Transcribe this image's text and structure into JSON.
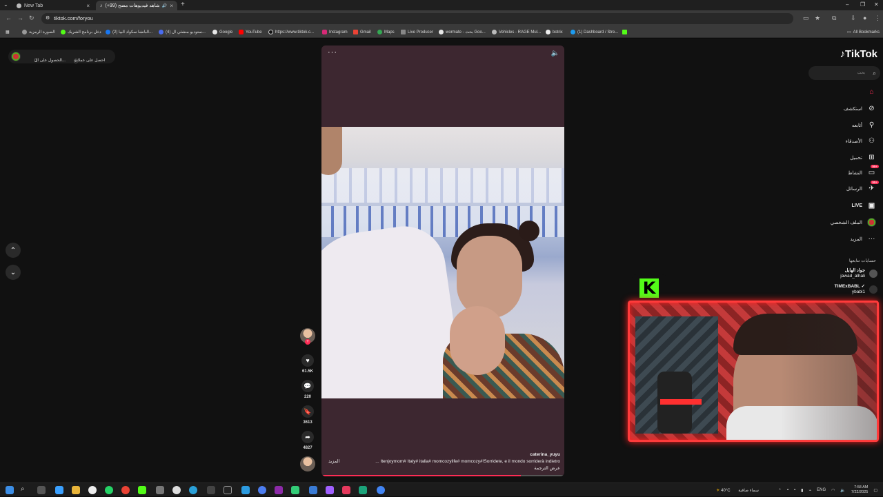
{
  "browser": {
    "tabs": [
      {
        "label": "New Tab",
        "active": false
      },
      {
        "label": "(+99) شاهد فيديوهات مضح...",
        "active": true
      }
    ],
    "new_tab": "+",
    "url": "tiktok.com/foryou",
    "all_bookmarks": "All Bookmarks",
    "bookmarks": [
      "الصورة الرمزية",
      "دخل برنامج الشريك",
      "(2) البانشا سكواد البيا...",
      "(4) ستوديو منشئي ال...",
      "Google",
      "YouTube",
      "https://www.tiktok.c...",
      "Instagram",
      "Gmail",
      "Maps",
      "Live Producer",
      "wormate - بحث Goo...",
      "Vehicles - RAGE Mul...",
      "botrix",
      "(1) Dashboard / Stre..."
    ]
  },
  "topleft": {
    "coins": "احصل على عملات",
    "app": "الحصول على ال..."
  },
  "sidebar": {
    "logo": "TikTok",
    "search_placeholder": "بحث",
    "items": [
      {
        "label": "",
        "icon": "home-icon"
      },
      {
        "label": "استكشف",
        "icon": "compass-icon"
      },
      {
        "label": "أتابعه",
        "icon": "user-follow-icon"
      },
      {
        "label": "الأصدقاء",
        "icon": "friends-icon"
      },
      {
        "label": "تحميل",
        "icon": "upload-icon"
      },
      {
        "label": "النشاط",
        "icon": "activity-icon",
        "badge": "99+"
      },
      {
        "label": "الرسائل",
        "icon": "messages-icon",
        "badge": "99+"
      },
      {
        "label": "LIVE",
        "icon": "live-icon"
      },
      {
        "label": "الملف الشخصي",
        "icon": "profile-avatar-icon"
      },
      {
        "label": "المزيد",
        "icon": "more-icon"
      }
    ],
    "following_title": "حسابات تتابعها",
    "accounts": [
      {
        "name": "جواد الهايل",
        "handle": "jawad_alhali"
      },
      {
        "name": "TIMExBABL ✓",
        "handle": "ybabl1"
      }
    ]
  },
  "video": {
    "username": "caterina_yuyu",
    "caption": "... Itenjoymom# Italy# italia# momcozylife# momcozy#!Sorridete, e il mondo sorriderà indietro",
    "more": "المزيد",
    "translate": "عرض الترجمة",
    "progress": 0.82
  },
  "actions": {
    "likes": "61.5K",
    "comments": "220",
    "saves": "3613",
    "shares": "4827"
  },
  "taskbar": {
    "weather": "40°C",
    "weather_text": "سماء صافية",
    "lang": "ENG",
    "time": "7:58 AM",
    "date": "7/22/2025"
  },
  "colors": {
    "accent": "#fe2c55",
    "kick": "#53fc18",
    "cam_border": "#ff3b3b"
  }
}
